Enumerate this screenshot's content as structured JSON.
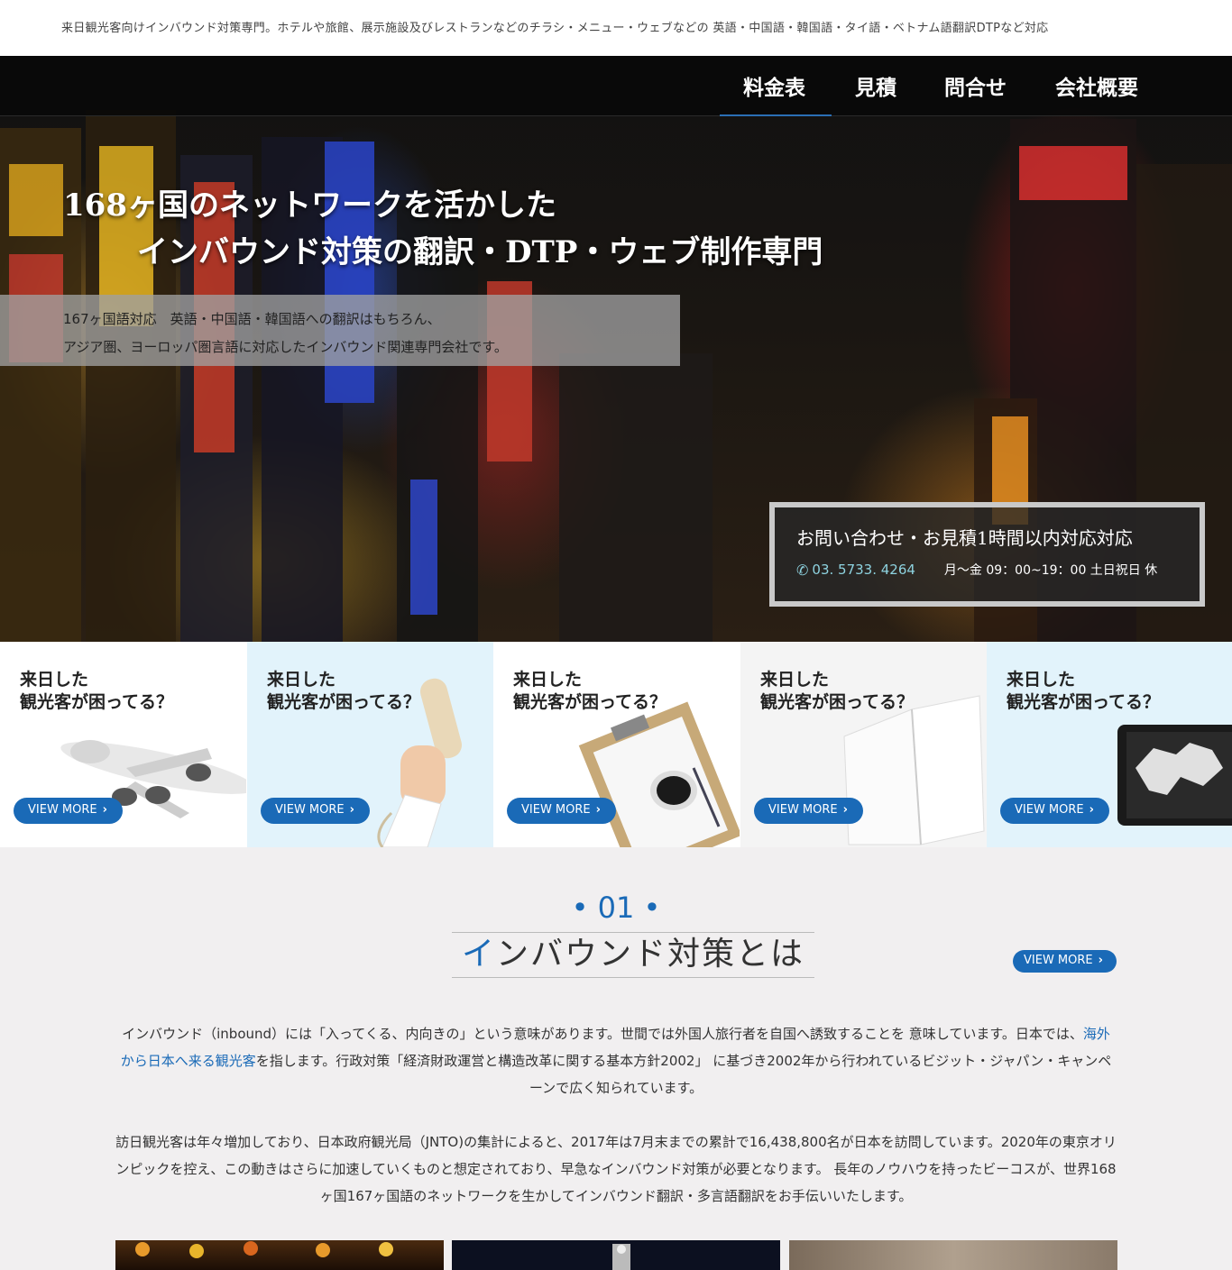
{
  "topbar": {
    "text": "来日観光客向けインバウンド対策専門。ホテルや旅館、展示施設及びレストランなどのチラシ・メニュー・ウェブなどの 英語・中国語・韓国語・タイ語・ベトナム語翻訳DTPなど対応"
  },
  "nav": {
    "items": [
      "料金表",
      "見積",
      "問合せ",
      "会社概要"
    ],
    "active_index": 0
  },
  "hero": {
    "title_line1": "168ヶ国のネットワークを活かした",
    "title_line2": "インバウンド対策の翻訳・DTP・ウェブ制作専門",
    "desc_line1": "167ヶ国語対応　英語・中国語・韓国語への翻訳はもちろん、",
    "desc_line2": "アジア圏、ヨーロッパ圏言語に対応したインバウンド関連専門会社です。"
  },
  "contact": {
    "title": "お問い合わせ・お見積1時間以内対応対応",
    "phone": "03. 5733. 4264",
    "hours": "月〜金 09：00~19：00 土日祝日 休",
    "phone_icon": "phone-icon"
  },
  "cards": [
    {
      "line1": "来日した",
      "line2": "観光客が困ってる？",
      "button": "VIEW MORE",
      "image": "airplane",
      "bg": "#ffffff"
    },
    {
      "line1": "来日した",
      "line2": "観光客が困ってる？",
      "button": "VIEW MORE",
      "image": "telephone-handset",
      "bg": "#e2f3fb"
    },
    {
      "line1": "来日した",
      "line2": "観光客が困ってる？",
      "button": "VIEW MORE",
      "image": "clipboard-coffee",
      "bg": "#ffffff"
    },
    {
      "line1": "来日した",
      "line2": "観光客が困ってる？",
      "button": "VIEW MORE",
      "image": "open-notebook",
      "bg": "#f4f4f4"
    },
    {
      "line1": "来日した",
      "line2": "観光客が困ってる？",
      "button": "VIEW MORE",
      "image": "tablet-world-map",
      "bg": "#e2f3fb"
    }
  ],
  "section1": {
    "number": "• 01 •",
    "title_accent": "イ",
    "title_rest": "ンバウンド対策とは",
    "button": "VIEW MORE",
    "para1_before": "インバウンド（inbound）には「入ってくる、内向きの」という意味があります。世間では外国人旅行者を自国へ誘致することを 意味しています。日本では、",
    "para1_link": "海外から日本へ来る観光客",
    "para1_after": "を指します。行政対策「経済財政運営と構造改革に関する基本方針2002」 に基づき2002年から行われているビジット・ジャパン・キャンペーンで広く知られています。",
    "para2": "訪日観光客は年々増加しており、日本政府観光局（JNTO)の集計によると、2017年は7月末までの累計で16,438,800名が日本を訪問しています。2020年の東京オリンピックを控え、この動きはさらに加速していくものと想定されており、早急なインバウンド対策が必要となります。 長年のノウハウを持ったビーコスが、世界168ヶ国167ヶ国語のネットワークを生かしてインバウンド翻訳・多言語翻訳をお手伝いいたします。"
  },
  "colors": {
    "accent": "#1a6ab7",
    "phone": "#8ed3e0",
    "section_bg": "#f1eff0"
  }
}
